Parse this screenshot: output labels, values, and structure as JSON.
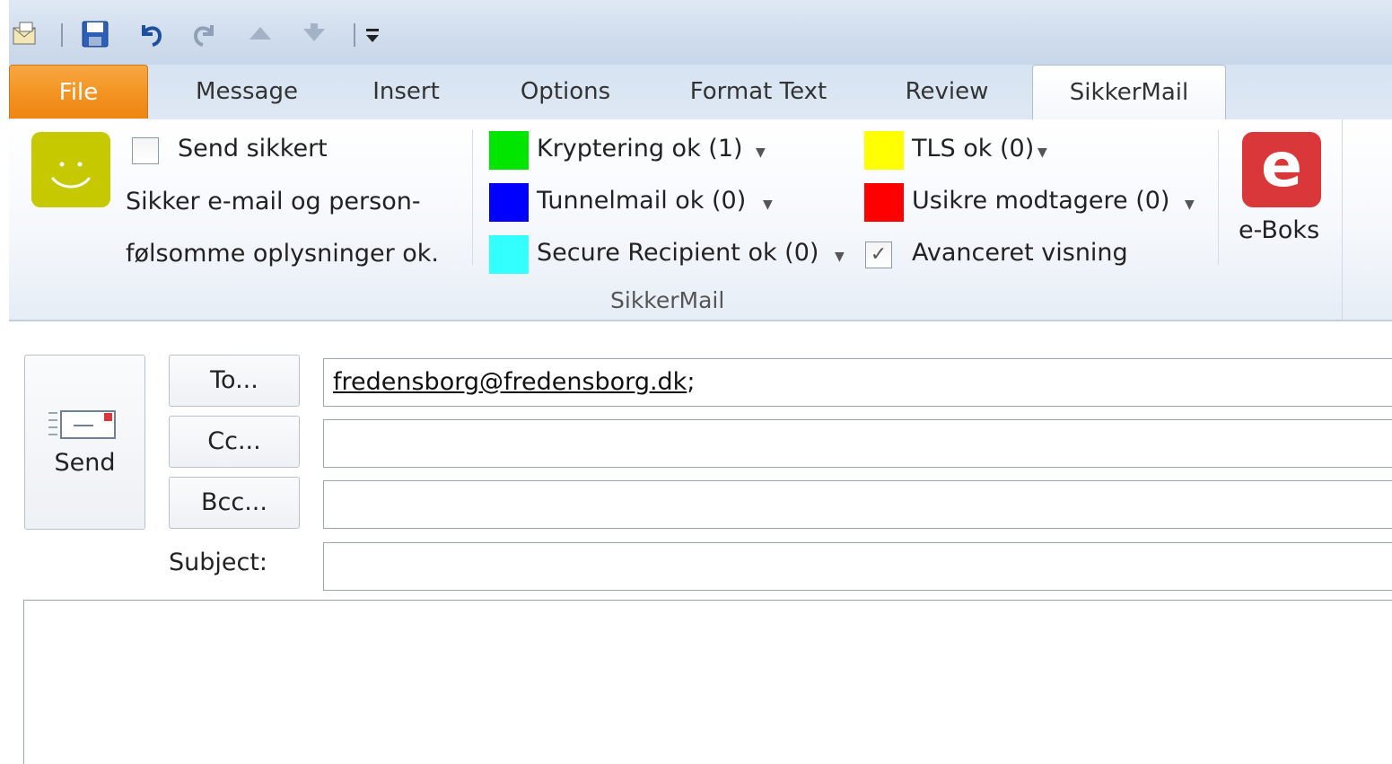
{
  "quick_access": {
    "icons": [
      "mail-icon",
      "save-icon",
      "undo-icon",
      "redo-icon",
      "up-arrow-icon",
      "down-arrow-icon",
      "customize-icon"
    ]
  },
  "tabs": [
    {
      "label": "File"
    },
    {
      "label": "Message"
    },
    {
      "label": "Insert"
    },
    {
      "label": "Options"
    },
    {
      "label": "Format Text"
    },
    {
      "label": "Review"
    },
    {
      "label": "SikkerMail"
    }
  ],
  "ribbon": {
    "send_secure_label": "Send sikkert",
    "status_line1": "Sikker e-mail og person-",
    "status_line2": "følsomme oplysninger ok.",
    "status_items": [
      {
        "label": "Kryptering ok (1)",
        "color": "#00e600"
      },
      {
        "label": "Tunnelmail ok (0)",
        "color": "#0000ff"
      },
      {
        "label": "Secure Recipient ok (0)",
        "color": "#33ffff"
      },
      {
        "label": "TLS ok (0)",
        "color": "#ffff00"
      },
      {
        "label": "Usikre modtagere (0)",
        "color": "#ff0000"
      }
    ],
    "advanced_label": "Avanceret visning",
    "group_label": "SikkerMail",
    "eboks_label": "e-Boks",
    "eboks_letter": "e",
    "eboks_color": "#d9373a",
    "smiley_color": "#c6c800"
  },
  "compose": {
    "send_label": "Send",
    "to_label": "To...",
    "cc_label": "Cc...",
    "bcc_label": "Bcc...",
    "subject_label": "Subject:",
    "to_value": "fredensborg@fredensborg.dk",
    "to_suffix": ";",
    "cc_value": "",
    "bcc_value": "",
    "subject_value": ""
  }
}
